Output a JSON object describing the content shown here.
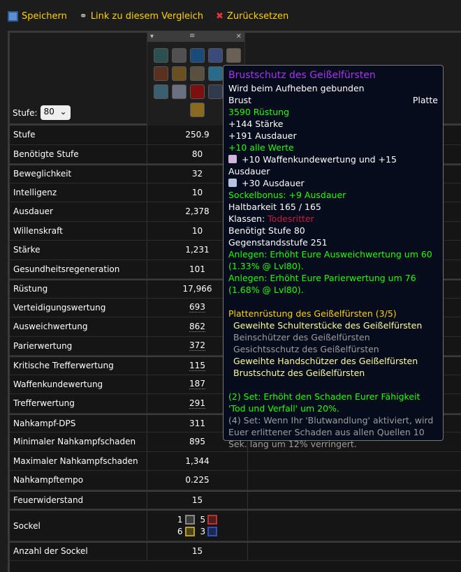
{
  "toolbar": {
    "save": "Speichern",
    "link": "Link zu diesem Vergleich",
    "reset": "Zurücksetzen"
  },
  "level": {
    "label": "Stufe:",
    "value": "80"
  },
  "stats": [
    {
      "label": "Stufe",
      "value": "250.9",
      "group": true
    },
    {
      "label": "Benötigte Stufe",
      "value": "80"
    },
    {
      "label": "Beweglichkeit",
      "value": "32",
      "group": true
    },
    {
      "label": "Intelligenz",
      "value": "10"
    },
    {
      "label": "Ausdauer",
      "value": "2,378"
    },
    {
      "label": "Willenskraft",
      "value": "10"
    },
    {
      "label": "Stärke",
      "value": "1,231"
    },
    {
      "label": "Gesundheitsregeneration",
      "value": "101"
    },
    {
      "label": "Rüstung",
      "value": "17,966",
      "group": true
    },
    {
      "label": "Verteidigungswertung",
      "value": "693",
      "dotted": true
    },
    {
      "label": "Ausweichwertung",
      "value": "862",
      "dotted": true
    },
    {
      "label": "Parierwertung",
      "value": "372",
      "dotted": true
    },
    {
      "label": "Kritische Trefferwertung",
      "value": "115",
      "dotted": true,
      "group": true
    },
    {
      "label": "Waffenkundewertung",
      "value": "187",
      "dotted": true
    },
    {
      "label": "Trefferwertung",
      "value": "291",
      "dotted": true
    },
    {
      "label": "Nahkampf-DPS",
      "value": "311",
      "group": true
    },
    {
      "label": "Minimaler Nahkampfschaden",
      "value": "895"
    },
    {
      "label": "Maximaler Nahkampfschaden",
      "value": "1,344"
    },
    {
      "label": "Nahkampftempo",
      "value": "0.225"
    },
    {
      "label": "Feuerwiderstand",
      "value": "15",
      "group": true
    }
  ],
  "sockets": {
    "label": "Sockel",
    "items": [
      {
        "count": "1",
        "color": "#888888"
      },
      {
        "count": "5",
        "color": "#c03030"
      },
      {
        "count": "6",
        "color": "#b8a020"
      },
      {
        "count": "3",
        "color": "#3050c0"
      }
    ]
  },
  "socket_count": {
    "label": "Anzahl der Sockel",
    "value": "15"
  },
  "tooltip": {
    "name": "Brustschutz des Geißelfürsten",
    "bind": "Wird beim Aufheben gebunden",
    "slot": "Brust",
    "type": "Platte",
    "armor": "3590 Rüstung",
    "str": "+144 Stärke",
    "sta": "+191 Ausdauer",
    "all": "+10 alle Werte",
    "gem1": "+10 Waffenkundewertung und +15 Ausdauer",
    "gem2": "+30 Ausdauer",
    "socket_bonus": "Sockelbonus: +9 Ausdauer",
    "durability": "Haltbarkeit 165 / 165",
    "classes_label": "Klassen: ",
    "classes": "Todesritter",
    "req": "Benötigt Stufe 80",
    "ilvl": "Gegenstandsstufe 251",
    "equip1": "Anlegen: Erhöht Eure Ausweichwertung um 60 (1.33% @ Lvl80).",
    "equip2": "Anlegen: Erhöht Eure Parierwertung um 76 (1.68% @ Lvl80).",
    "set_name": "Plattenrüstung des Geißelfürsten (3/5)",
    "set_items": [
      {
        "name": "Geweihte Schulterstücke des Geißelfürsten",
        "owned": true
      },
      {
        "name": "Beinschützer des Geißelfürsten",
        "owned": false
      },
      {
        "name": "Gesichtsschutz des Geißelfürsten",
        "owned": false
      },
      {
        "name": "Geweihte Handschützer des Geißelfürsten",
        "owned": true
      },
      {
        "name": "Brustschutz des Geißelfürsten",
        "owned": true
      }
    ],
    "bonus2": "(2) Set: Erhöht den Schaden Eurer Fähigkeit 'Tod und Verfall' um 20%.",
    "bonus4": "(4) Set: Wenn Ihr 'Blutwandlung' aktiviert, wird Euer erlittener Schaden aus allen Quellen 10 Sek. lang um 12% verringert."
  }
}
